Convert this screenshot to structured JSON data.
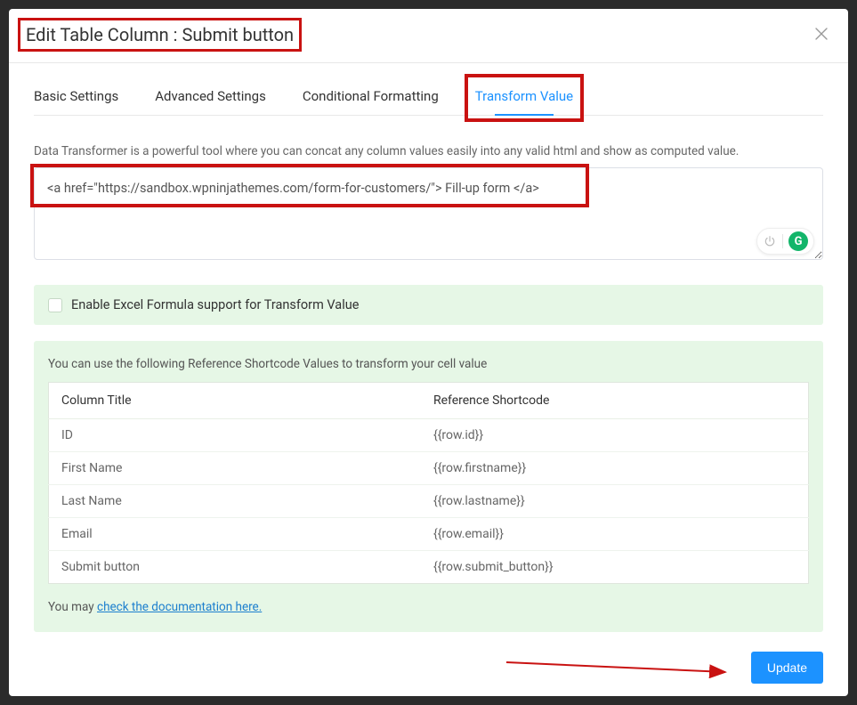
{
  "modal": {
    "title": "Edit Table Column : Submit button"
  },
  "tabs": [
    {
      "label": "Basic Settings",
      "active": false
    },
    {
      "label": "Advanced Settings",
      "active": false
    },
    {
      "label": "Conditional Formatting",
      "active": false
    },
    {
      "label": "Transform Value",
      "active": true
    }
  ],
  "transform": {
    "description": "Data Transformer is a powerful tool where you can concat any column values easily into any valid html and show as computed value.",
    "value": "<a href=\"https://sandbox.wpninjathemes.com/form-for-customers/\"> Fill-up form </a>"
  },
  "checkbox": {
    "label": "Enable Excel Formula support for Transform Value",
    "checked": false
  },
  "reference": {
    "description": "You can use the following Reference Shortcode Values to transform your cell value",
    "headers": {
      "col1": "Column Title",
      "col2": "Reference Shortcode"
    },
    "rows": [
      {
        "title": "ID",
        "shortcode": "{{row.id}}"
      },
      {
        "title": "First Name",
        "shortcode": "{{row.firstname}}"
      },
      {
        "title": "Last Name",
        "shortcode": "{{row.lastname}}"
      },
      {
        "title": "Email",
        "shortcode": "{{row.email}}"
      },
      {
        "title": "Submit button",
        "shortcode": "{{row.submit_button}}"
      }
    ],
    "doc_prefix": "You may ",
    "doc_link": "check the documentation here."
  },
  "footer": {
    "update_label": "Update"
  },
  "icons": {
    "grammarly": "G"
  }
}
